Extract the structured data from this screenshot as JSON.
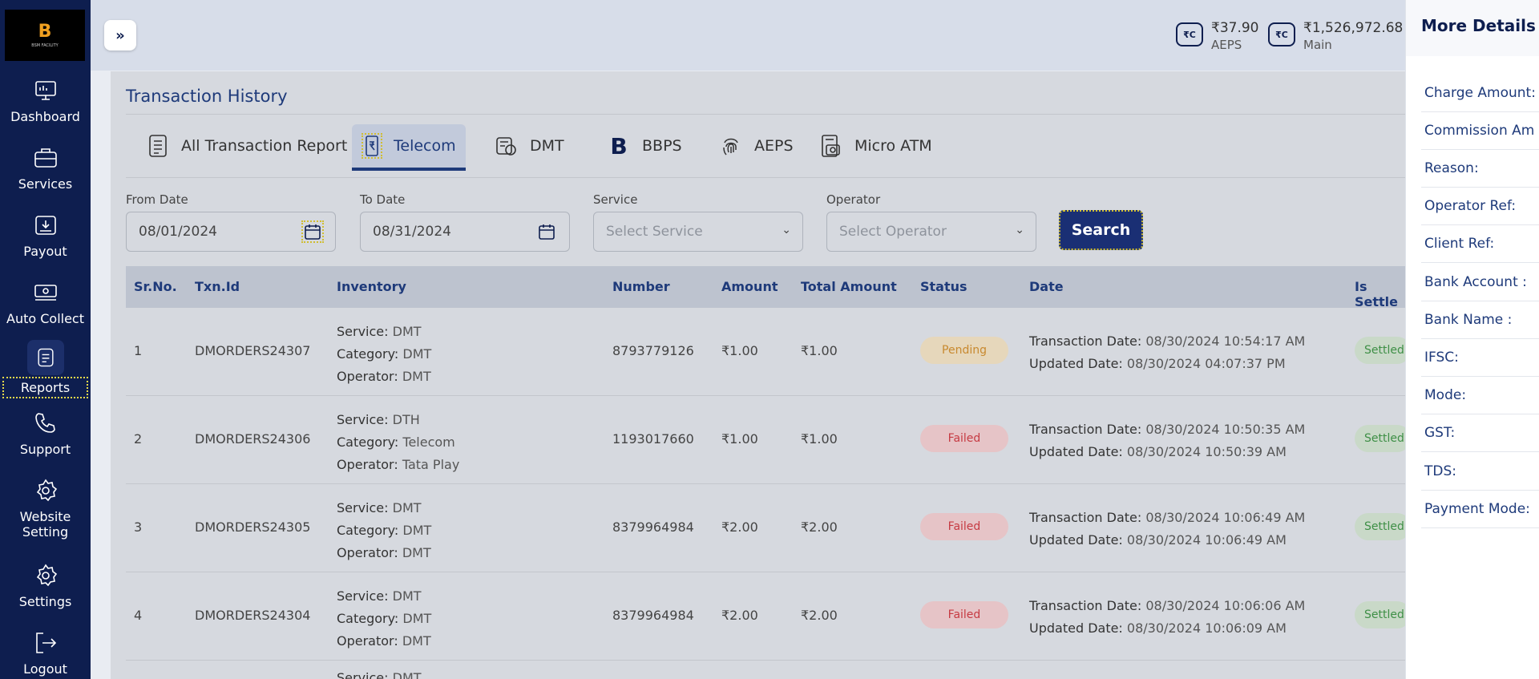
{
  "app": {
    "logo_text": "B",
    "logo_subtext": "BSM FACILITY"
  },
  "sidebar": {
    "items": [
      {
        "label": "Dashboard",
        "icon": "dashboard-icon"
      },
      {
        "label": "Services",
        "icon": "briefcase-icon"
      },
      {
        "label": "Payout",
        "icon": "payout-icon"
      },
      {
        "label": "Auto Collect",
        "icon": "money-icon"
      },
      {
        "label": "Reports",
        "icon": "document-icon"
      },
      {
        "label": "Support",
        "icon": "phone-icon"
      },
      {
        "label": "Website Setting",
        "icon": "gear-icon"
      },
      {
        "label": "Settings",
        "icon": "gear-icon"
      },
      {
        "label": "Logout",
        "icon": "logout-icon"
      }
    ]
  },
  "header": {
    "toggle_label": "»",
    "wallets": [
      {
        "amount": "₹37.90",
        "label": "AEPS"
      },
      {
        "amount": "₹1,526,972.68",
        "label": "Main"
      }
    ]
  },
  "page": {
    "title": "Transaction History",
    "tabs": [
      {
        "label": "All Transaction Report"
      },
      {
        "label": "Telecom"
      },
      {
        "label": "DMT"
      },
      {
        "label": "BBPS"
      },
      {
        "label": "AEPS"
      },
      {
        "label": "Micro ATM"
      }
    ],
    "filters": {
      "from_date_label": "From Date",
      "from_date_value": "08/01/2024",
      "to_date_label": "To Date",
      "to_date_value": "08/31/2024",
      "service_label": "Service",
      "service_placeholder": "Select Service",
      "operator_label": "Operator",
      "operator_placeholder": "Select Operator",
      "search_label": "Search"
    }
  },
  "table": {
    "columns": [
      "Sr.No.",
      "Txn.Id",
      "Inventory",
      "Number",
      "Amount",
      "Total Amount",
      "Status",
      "Date",
      "Is Settle"
    ],
    "inventory_keys": {
      "service": "Service:",
      "category": "Category:",
      "operator": "Operator:"
    },
    "date_keys": {
      "txn": "Transaction Date:",
      "upd": "Updated Date:"
    },
    "rows": [
      {
        "sr": "1",
        "txn": "DMORDERS24307",
        "service": "DMT",
        "category": "DMT",
        "operator": "DMT",
        "number": "8793779126",
        "amount": "₹1.00",
        "total": "₹1.00",
        "status": "Pending",
        "txn_date": "08/30/2024 10:54:17 AM",
        "upd_date": "08/30/2024 04:07:37 PM",
        "settle": "Settled"
      },
      {
        "sr": "2",
        "txn": "DMORDERS24306",
        "service": "DTH",
        "category": "Telecom",
        "operator": "Tata Play",
        "number": "1193017660",
        "amount": "₹1.00",
        "total": "₹1.00",
        "status": "Failed",
        "txn_date": "08/30/2024 10:50:35 AM",
        "upd_date": "08/30/2024 10:50:39 AM",
        "settle": "Settled"
      },
      {
        "sr": "3",
        "txn": "DMORDERS24305",
        "service": "DMT",
        "category": "DMT",
        "operator": "DMT",
        "number": "8379964984",
        "amount": "₹2.00",
        "total": "₹2.00",
        "status": "Failed",
        "txn_date": "08/30/2024 10:06:49 AM",
        "upd_date": "08/30/2024 10:06:49 AM",
        "settle": "Settled"
      },
      {
        "sr": "4",
        "txn": "DMORDERS24304",
        "service": "DMT",
        "category": "DMT",
        "operator": "DMT",
        "number": "8379964984",
        "amount": "₹2.00",
        "total": "₹2.00",
        "status": "Failed",
        "txn_date": "08/30/2024 10:06:06 AM",
        "upd_date": "08/30/2024 10:06:09 AM",
        "settle": "Settled"
      }
    ],
    "partial_row": {
      "service_key": "Service:",
      "service": "DMT"
    }
  },
  "details_panel": {
    "title": "More Details",
    "fields": [
      "Charge Amount:",
      "Commission Am",
      "Reason:",
      "Operator Ref:",
      "Client Ref:",
      "Bank Account :",
      "Bank Name :",
      "IFSC:",
      "Mode:",
      "GST:",
      "TDS:",
      "Payment Mode:"
    ]
  }
}
